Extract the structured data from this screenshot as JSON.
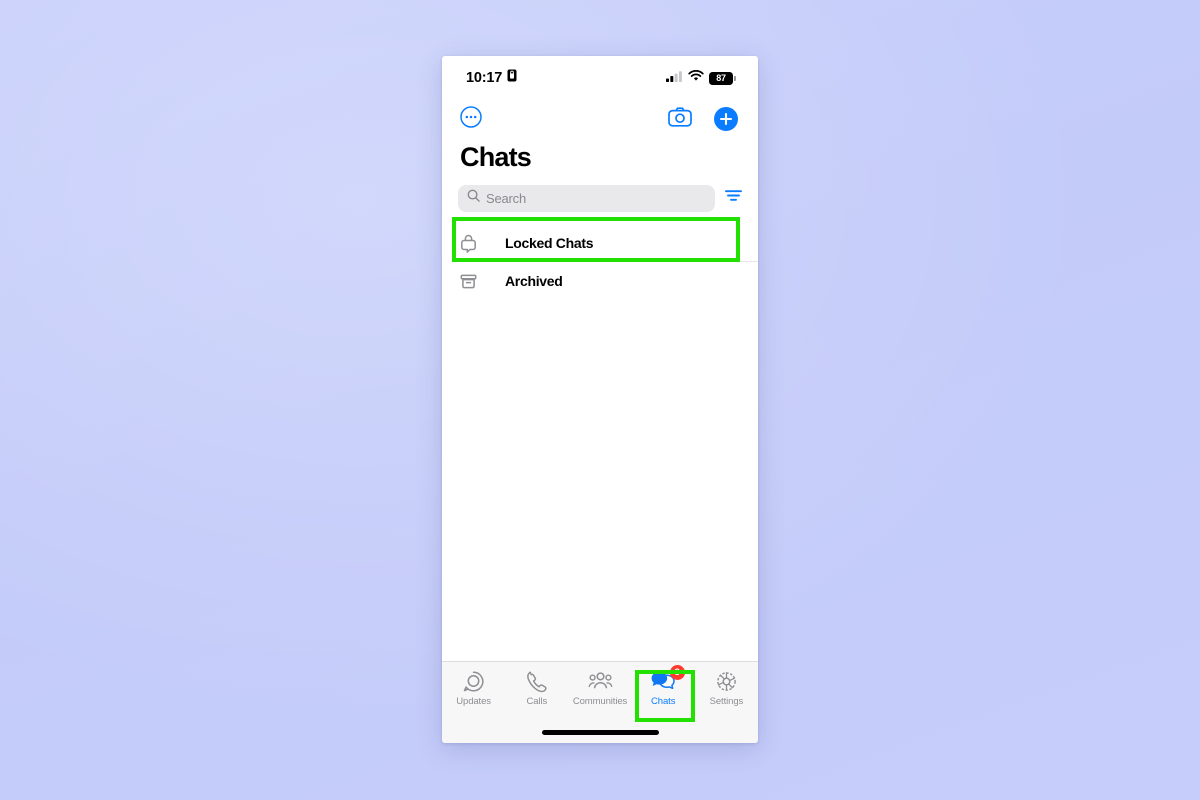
{
  "backdrop": {
    "color": "#c6cdfa"
  },
  "status_bar": {
    "time": "10:17",
    "recording_icon": "lock-portrait-icon",
    "cellular_icon": "cellular-signal-icon",
    "wifi_icon": "wifi-icon",
    "battery_icon": "battery-icon",
    "battery_level": "87"
  },
  "top_nav": {
    "more_options_icon": "more-circle-icon",
    "camera_icon": "camera-icon",
    "new_chat_icon": "plus-icon",
    "accent_color": "#0a7cff"
  },
  "header": {
    "title": "Chats"
  },
  "search": {
    "placeholder": "Search",
    "search_icon": "search-icon",
    "filter_icon": "filter-icon",
    "filter_color": "#0a7cff",
    "field_bg": "#e9e9ec"
  },
  "list": {
    "rows": [
      {
        "label": "Locked Chats",
        "icon": "lock-chat-icon",
        "highlighted": true
      },
      {
        "label": "Archived",
        "icon": "archive-box-icon",
        "highlighted": false
      }
    ]
  },
  "tab_bar": {
    "tabs": [
      {
        "label": "Updates",
        "icon": "status-updates-icon",
        "active": false,
        "badge": ""
      },
      {
        "label": "Calls",
        "icon": "phone-icon",
        "active": false,
        "badge": ""
      },
      {
        "label": "Communities",
        "icon": "communities-icon",
        "active": false,
        "badge": ""
      },
      {
        "label": "Chats",
        "icon": "chat-bubbles-icon",
        "active": true,
        "badge": "3"
      },
      {
        "label": "Settings",
        "icon": "gear-icon",
        "active": false,
        "badge": ""
      }
    ],
    "active_color": "#0a7cff",
    "inactive_color": "#8e8e93",
    "badge_color": "#ff3b30"
  },
  "annotations": {
    "highlight_color": "#22e000",
    "boxes": [
      {
        "target": "Locked Chats"
      },
      {
        "target": "Chats"
      }
    ]
  }
}
